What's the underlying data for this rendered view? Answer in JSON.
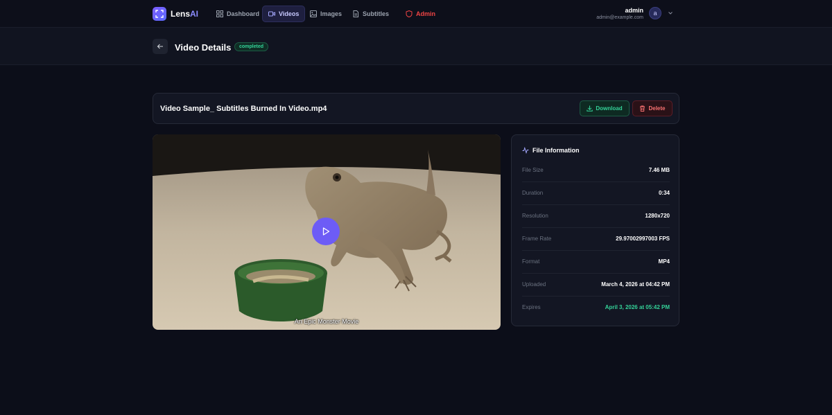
{
  "brand": {
    "name_part1": "Lens",
    "name_part2": "AI"
  },
  "nav": {
    "items": [
      {
        "label": "Dashboard",
        "icon": "dashboard-icon"
      },
      {
        "label": "Videos",
        "icon": "video-icon"
      },
      {
        "label": "Images",
        "icon": "image-icon"
      },
      {
        "label": "Subtitles",
        "icon": "subtitles-icon"
      },
      {
        "label": "Admin",
        "icon": "shield-icon"
      }
    ],
    "active": "Videos"
  },
  "user": {
    "name": "admin",
    "email": "admin@example.com",
    "avatar_letter": "a"
  },
  "header": {
    "title": "Video Details",
    "status": "completed"
  },
  "file": {
    "name": "Video Sample_ Subtitles Burned In Video.mp4"
  },
  "actions": {
    "download_label": "Download",
    "delete_label": "Delete"
  },
  "video": {
    "subtitle": "An Epic Monster Movie"
  },
  "info": {
    "title": "File Information",
    "rows": [
      {
        "label": "File Size",
        "value": "7.46 MB"
      },
      {
        "label": "Duration",
        "value": "0:34"
      },
      {
        "label": "Resolution",
        "value": "1280x720"
      },
      {
        "label": "Frame Rate",
        "value": "29.97002997003 FPS"
      },
      {
        "label": "Format",
        "value": "MP4"
      },
      {
        "label": "Uploaded",
        "value": "March 4, 2026 at 04:42 PM"
      },
      {
        "label": "Expires",
        "value": "April 3, 2026 at 05:42 PM"
      }
    ]
  },
  "colors": {
    "accent": "#6d5cf6",
    "success": "#34d399",
    "danger": "#f87171",
    "admin": "#ef4444",
    "background": "#0c0e19"
  }
}
